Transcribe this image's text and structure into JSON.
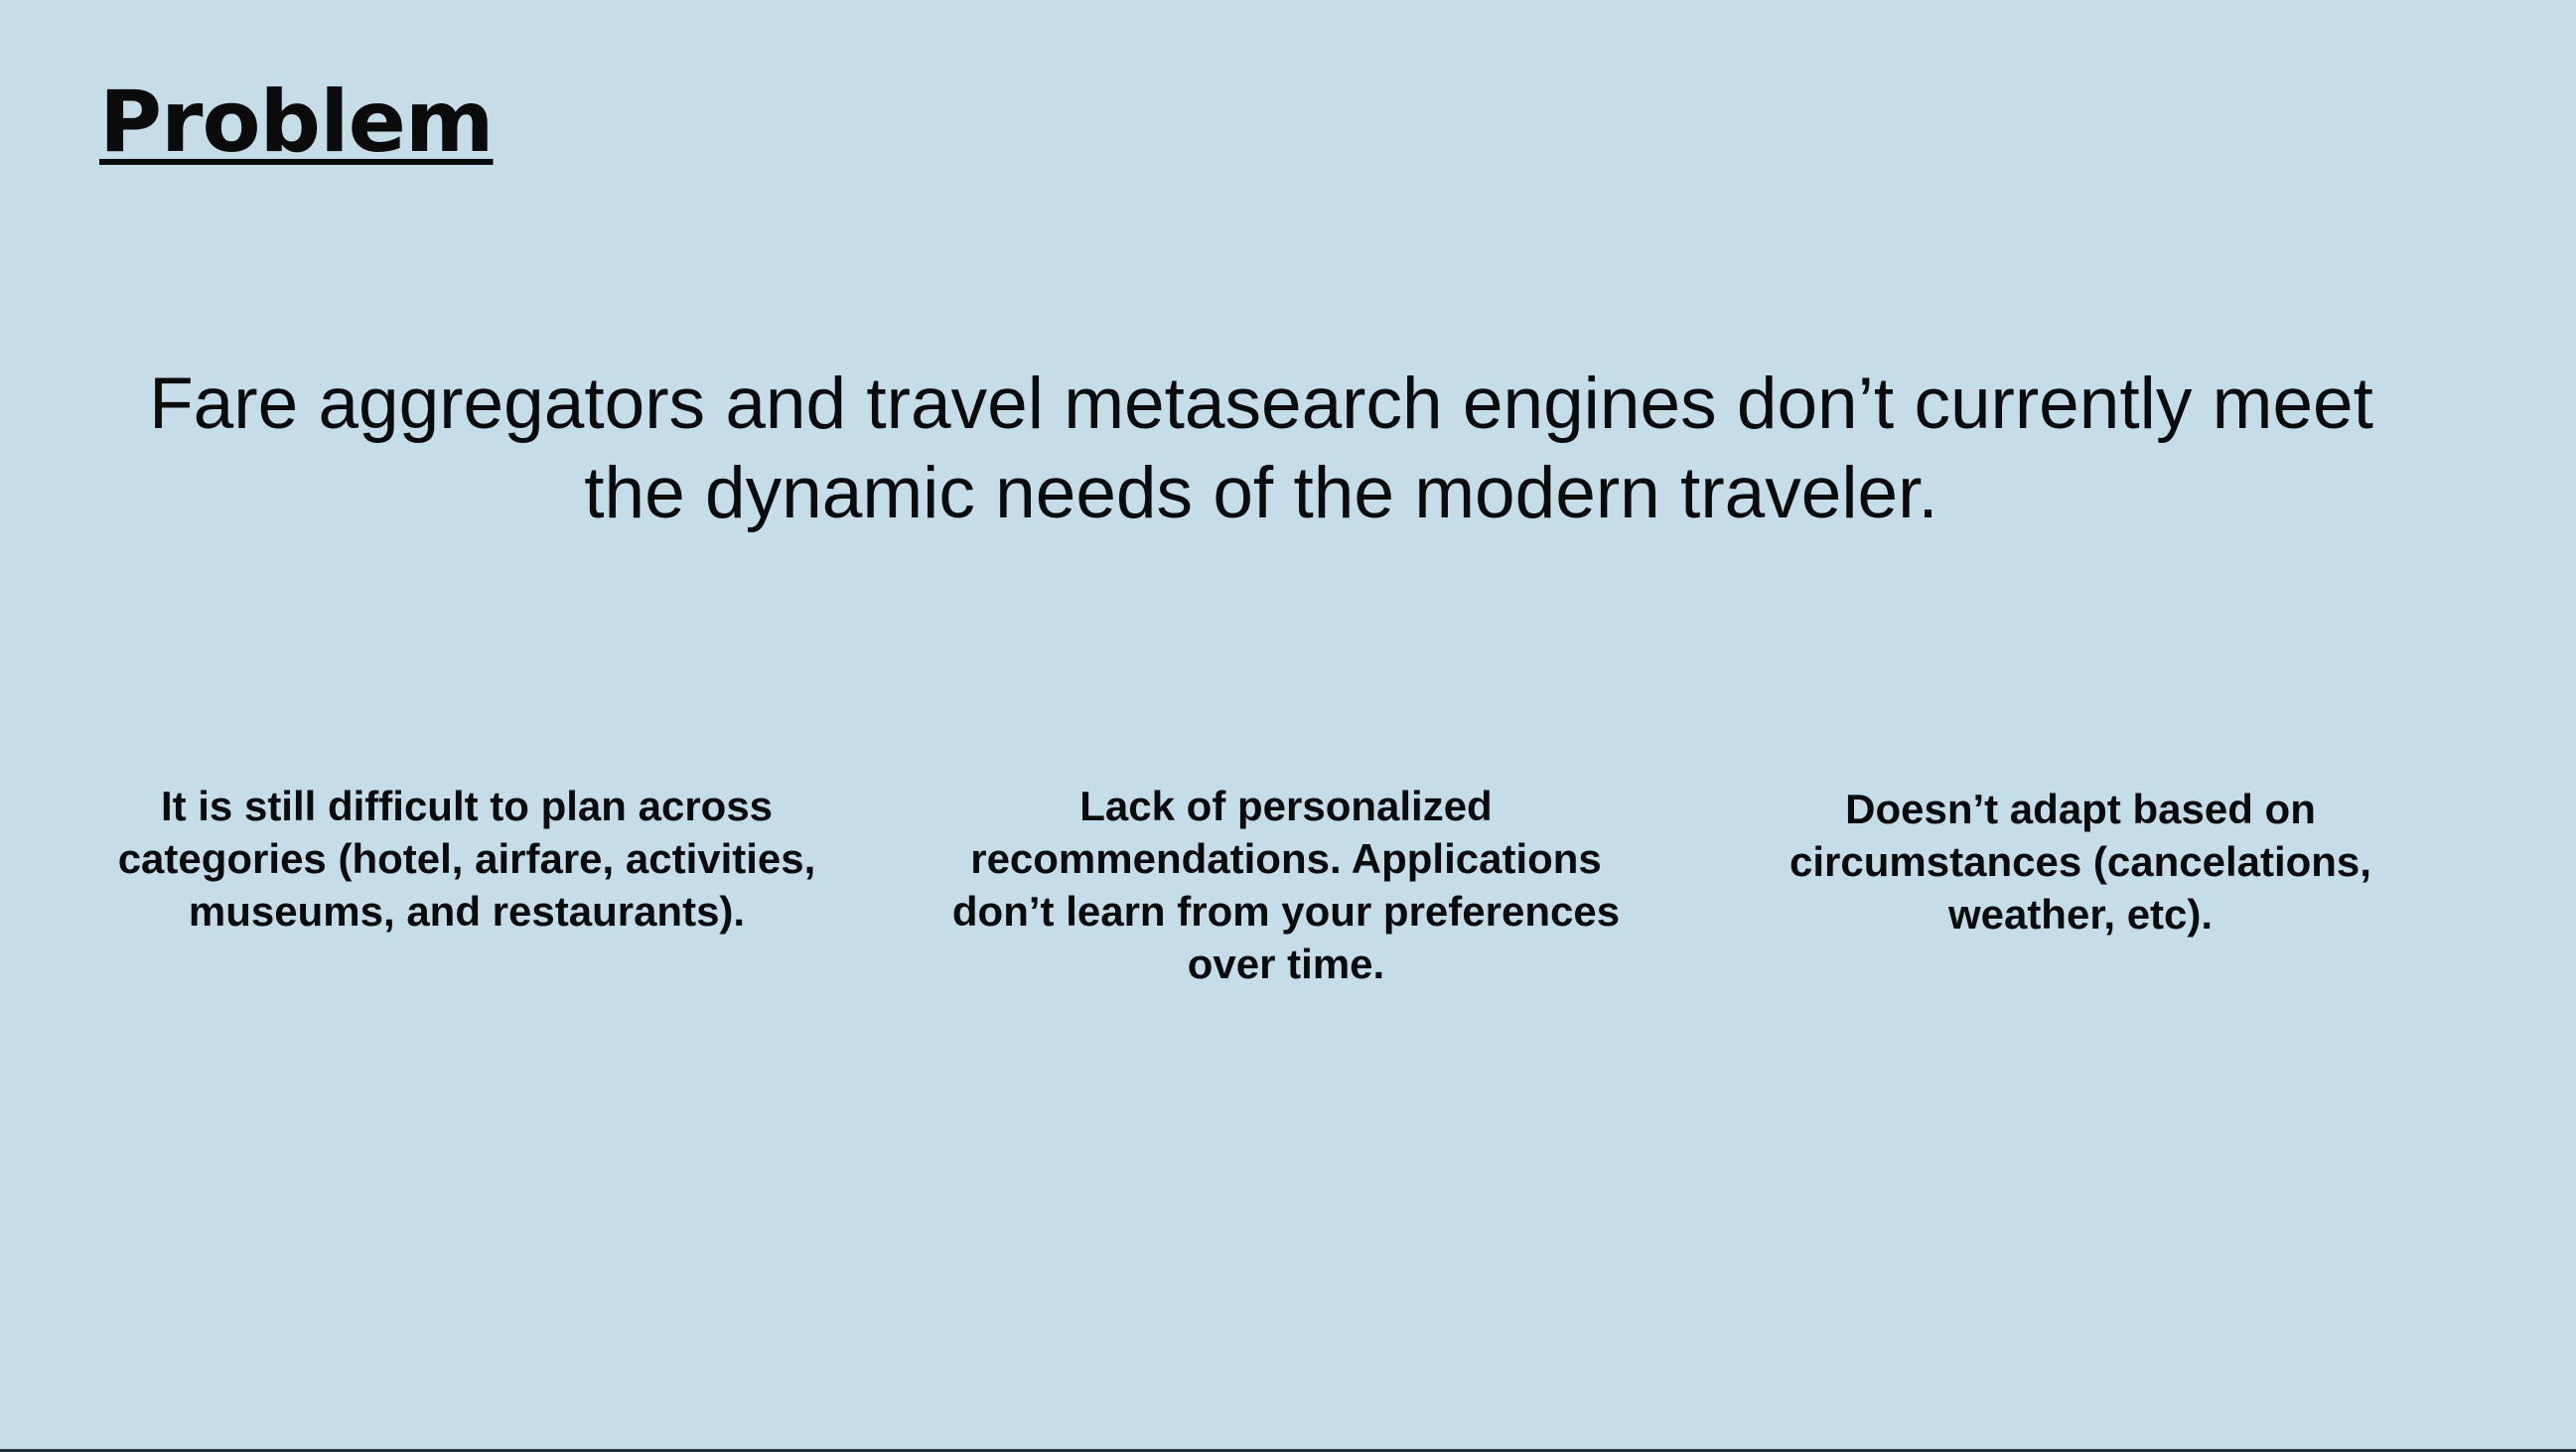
{
  "slide": {
    "title": "Problem",
    "headline": "Fare aggregators and travel metasearch engines don’t currently meet the dynamic needs of the modern traveler.",
    "points": [
      {
        "text": "It is still difficult to plan across categories (hotel, airfare, activities, museums, and restaurants)."
      },
      {
        "text": "Lack of personalized recommendations. Applications don’t learn from your preferences over time."
      },
      {
        "text": "Doesn’t adapt based on circumstances (cancelations, weather, etc)."
      }
    ]
  },
  "colors": {
    "background": "#c5dde8",
    "text": "#0b0b0b"
  }
}
